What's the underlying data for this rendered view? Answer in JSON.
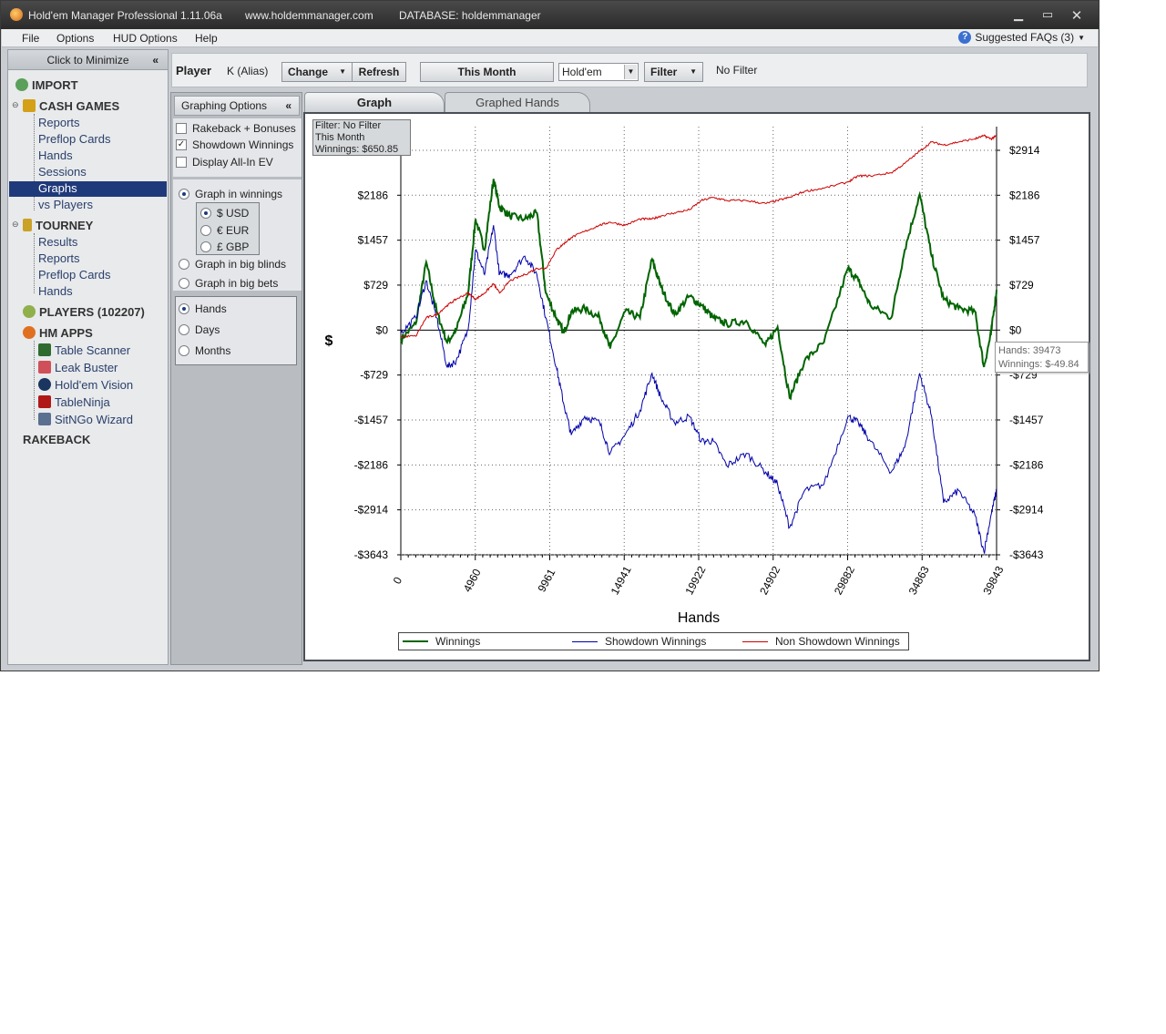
{
  "window": {
    "app_title": "Hold'em Manager Professional 1.11.06a",
    "url": "www.holdemmanager.com",
    "database": "DATABASE: holdemmanager"
  },
  "menu": {
    "file": "File",
    "options": "Options",
    "hud_options": "HUD Options",
    "help": "Help",
    "faq": "Suggested FAQs (3)"
  },
  "sidebar": {
    "minimize": "Click to Minimize",
    "import": "IMPORT",
    "cash_games": "CASH GAMES",
    "cash_items": [
      "Reports",
      "Preflop Cards",
      "Hands",
      "Sessions",
      "Graphs",
      "vs Players"
    ],
    "tourney": "TOURNEY",
    "tourney_items": [
      "Results",
      "Reports",
      "Preflop Cards",
      "Hands"
    ],
    "players": "PLAYERS (102207)",
    "hm_apps": "HM APPS",
    "apps": [
      "Table Scanner",
      "Leak Buster",
      "Hold'em Vision",
      "TableNinja",
      "SitNGo Wizard"
    ],
    "rakeback": "RAKEBACK"
  },
  "toolbar": {
    "player_label": "Player",
    "player_name": "K (Alias)",
    "change": "Change",
    "refresh": "Refresh",
    "period": "This Month",
    "game": "Hold'em",
    "filter": "Filter",
    "filter_status": "No Filter"
  },
  "graph_options": {
    "header": "Graphing Options",
    "rakeback": "Rakeback + Bonuses",
    "showdown": "Showdown Winnings",
    "allin_ev": "Display All-In EV",
    "graph_winnings": "Graph in winnings",
    "usd": "$ USD",
    "eur": "€ EUR",
    "gbp": "£ GBP",
    "big_blinds": "Graph in big blinds",
    "big_bets": "Graph in big bets",
    "hands": "Hands",
    "days": "Days",
    "months": "Months"
  },
  "tabs": {
    "graph": "Graph",
    "graphed_hands": "Graphed Hands"
  },
  "info_box": {
    "line1": "Filter: No Filter",
    "line2": "This Month",
    "line3": "Winnings: $650.85"
  },
  "tooltip": {
    "line1": "Hands: 39473",
    "line2": "Winnings: $-49.84"
  },
  "chart_data": {
    "type": "line",
    "xlabel": "Hands",
    "ylabel": "$",
    "x_ticks": [
      "0",
      "4960",
      "9961",
      "14941",
      "19922",
      "24902",
      "29882",
      "34863",
      "39843"
    ],
    "y_ticks": [
      "$2914",
      "$2186",
      "$1457",
      "$729",
      "$0",
      "-$729",
      "-$1457",
      "-$2186",
      "-$2914",
      "-$3643"
    ],
    "y_tick_values": [
      2914,
      2186,
      1457,
      729,
      0,
      -729,
      -1457,
      -2186,
      -2914,
      -3643
    ],
    "xlim": [
      0,
      39843
    ],
    "ylim": [
      -3643,
      3400
    ],
    "grid": true,
    "legend_position": "bottom",
    "series": [
      {
        "name": "Winnings",
        "color": "#006400",
        "x": [
          0,
          1000,
          1700,
          2400,
          3100,
          3700,
          4500,
          5000,
          5600,
          6200,
          6600,
          7300,
          8300,
          9100,
          9700,
          10400,
          10900,
          11400,
          12300,
          13300,
          14000,
          15000,
          16000,
          16800,
          17400,
          18300,
          19300,
          20100,
          20900,
          21800,
          23100,
          24400,
          25200,
          26000,
          27000,
          28300,
          29900,
          30600,
          31400,
          32800,
          33700,
          34700,
          35500,
          36300,
          37300,
          38400,
          39000,
          39473,
          39843
        ],
        "y": [
          -150,
          100,
          1100,
          300,
          -200,
          0,
          600,
          1800,
          1300,
          2450,
          2000,
          1850,
          1800,
          1900,
          600,
          200,
          -50,
          300,
          350,
          200,
          -300,
          300,
          200,
          1150,
          700,
          250,
          550,
          400,
          200,
          100,
          150,
          -250,
          50,
          -1100,
          -500,
          -200,
          1000,
          800,
          400,
          200,
          1300,
          2200,
          1200,
          500,
          350,
          300,
          -600,
          -49.84,
          650.85
        ]
      },
      {
        "name": "Showdown Winnings",
        "color": "#0000aa",
        "x": [
          0,
          1000,
          1700,
          2400,
          3100,
          3700,
          4500,
          5000,
          5600,
          6200,
          6600,
          7300,
          8300,
          9100,
          9700,
          10400,
          10900,
          11400,
          12300,
          13300,
          14000,
          15000,
          16000,
          16800,
          17400,
          18300,
          19300,
          20100,
          20900,
          21800,
          23100,
          24400,
          25200,
          26000,
          27000,
          28300,
          29900,
          30600,
          31400,
          32800,
          33700,
          34700,
          35500,
          36300,
          37300,
          38400,
          39000,
          39473,
          39843
        ],
        "y": [
          -50,
          200,
          800,
          200,
          -600,
          -500,
          0,
          1300,
          900,
          1700,
          900,
          900,
          1200,
          900,
          200,
          -600,
          -1200,
          -1700,
          -1400,
          -1500,
          -2000,
          -1700,
          -1300,
          -700,
          -1100,
          -1500,
          -1400,
          -1800,
          -1800,
          -2200,
          -2000,
          -2300,
          -2500,
          -3200,
          -2600,
          -2500,
          -1400,
          -1500,
          -1800,
          -2300,
          -1900,
          -700,
          -1400,
          -2800,
          -2600,
          -3000,
          -3600,
          -3000,
          -2600
        ]
      },
      {
        "name": "Non Showdown Winnings",
        "color": "#cc0000",
        "x": [
          0,
          1000,
          1700,
          2400,
          3100,
          3700,
          4500,
          5000,
          5600,
          6200,
          6600,
          7300,
          8300,
          9100,
          9700,
          10400,
          10900,
          11400,
          12300,
          13300,
          14000,
          15000,
          16000,
          16800,
          17400,
          18300,
          19300,
          20100,
          20900,
          21800,
          23100,
          24400,
          25200,
          26000,
          27000,
          28300,
          29900,
          30600,
          31400,
          32800,
          33700,
          34700,
          35500,
          36300,
          37300,
          38400,
          39000,
          39473,
          39843
        ],
        "y": [
          -100,
          -100,
          200,
          250,
          400,
          500,
          600,
          500,
          600,
          750,
          600,
          800,
          900,
          1000,
          1000,
          1300,
          1400,
          1500,
          1600,
          1700,
          1750,
          1700,
          1800,
          1800,
          1850,
          1900,
          1950,
          2100,
          2150,
          2100,
          2100,
          2050,
          2100,
          2150,
          2250,
          2300,
          2400,
          2500,
          2500,
          2550,
          2700,
          2900,
          3050,
          3000,
          3050,
          3100,
          3150,
          3100,
          3150
        ]
      }
    ]
  }
}
